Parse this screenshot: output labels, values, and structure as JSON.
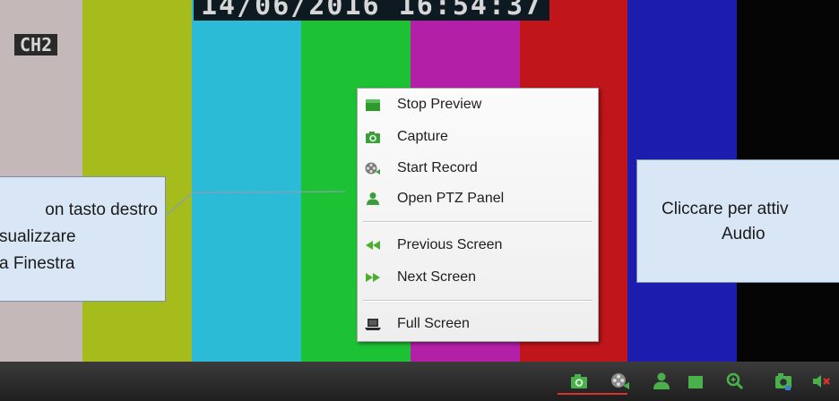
{
  "video": {
    "timestamp": "14/06/2016 16:54:37",
    "channel": "CH2",
    "bar_colors": [
      "#c4b8b8",
      "#a6bc1c",
      "#2bbbd6",
      "#1dc234",
      "#b41fa8",
      "#c0151b",
      "#1c1cae",
      "#050505"
    ]
  },
  "context_menu": {
    "items": [
      {
        "label": "Stop Preview",
        "icon": "stop-preview-icon"
      },
      {
        "label": "Capture",
        "icon": "camera-icon"
      },
      {
        "label": "Start Record",
        "icon": "film-reel-icon"
      },
      {
        "label": "Open PTZ Panel",
        "icon": "ptz-person-icon"
      },
      {
        "label": "Previous Screen",
        "icon": "rewind-icon"
      },
      {
        "label": "Next Screen",
        "icon": "fast-forward-icon"
      },
      {
        "label": "Full Screen",
        "icon": "laptop-icon"
      }
    ]
  },
  "callouts": {
    "left": [
      "on tasto destro",
      "sualizzare",
      "a Finestra"
    ],
    "right": [
      "Cliccare per attiv",
      "Audio"
    ]
  },
  "toolbar": {
    "icons": [
      "camera-icon",
      "film-reel-icon",
      "ptz-person-icon",
      "stop-preview-icon",
      "zoom-icon",
      "camera-switch-icon",
      "speaker-mute-icon"
    ],
    "accent": "#d8342b"
  }
}
